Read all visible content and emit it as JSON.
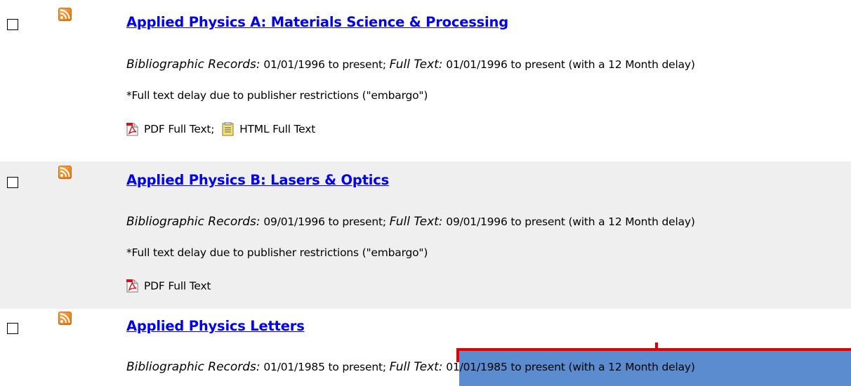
{
  "records": [
    {
      "title": "Applied Physics A: Materials Science & Processing",
      "biblio_label": "Bibliographic Records:",
      "biblio_value": "01/01/1996 to present;",
      "fulltext_label": "Full Text:",
      "fulltext_value": "01/01/1996 to present (with a 12 Month delay)",
      "note": "*Full text delay due to publisher restrictions (\"embargo\")",
      "pdf_label": "PDF Full Text;",
      "html_label": "HTML Full Text"
    },
    {
      "title": "Applied Physics B: Lasers & Optics",
      "biblio_label": "Bibliographic Records:",
      "biblio_value": "09/01/1996 to present;",
      "fulltext_label": "Full Text:",
      "fulltext_value": "09/01/1996 to present (with a 12 Month delay)",
      "note": "*Full text delay due to publisher restrictions (\"embargo\")",
      "pdf_label": "PDF Full Text"
    },
    {
      "title": "Applied Physics Letters",
      "biblio_label": "Bibliographic Records:",
      "biblio_value": "01/01/1985 to present;",
      "fulltext_label": "Full Text:",
      "fulltext_value": "01/01/1985 to present (with a 12 Month delay)"
    }
  ],
  "icons": {
    "rss": "rss-feed-icon",
    "pdf": "pdf-icon",
    "html": "html-document-icon",
    "checkbox": "checkbox"
  },
  "colors": {
    "link": "#0000ee",
    "alt_row": "#efefef",
    "rss_orange": "#f08a24",
    "annotation_red": "#e00000",
    "annotation_blue": "#5b8ccf"
  }
}
